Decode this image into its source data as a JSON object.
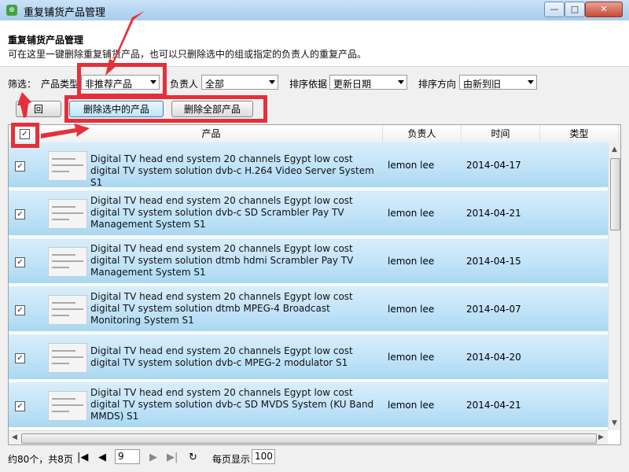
{
  "window": {
    "title": "重复铺货产品管理",
    "app_icon": "app-logo-icon",
    "controls": {
      "minimize": "—",
      "maximize": "□",
      "close": "✕"
    }
  },
  "header": {
    "title": "重复铺货产品管理",
    "description": "可在这里一键删除重复铺货产品，也可以只删除选中的组或指定的负责人的重复产品。"
  },
  "filters": {
    "filter_label": "筛选：",
    "product_type_label": "产品类型",
    "product_type_value": "非推荐产品",
    "owner_label": "负责人",
    "owner_value": "全部",
    "sort_by_label": "排序依据",
    "sort_by_value": "更新日期",
    "sort_dir_label": "排序方向",
    "sort_dir_value": "由新到旧"
  },
  "actions": {
    "back_label": "回",
    "delete_selected_label": "删除选中的产品",
    "delete_all_label": "删除全部产品"
  },
  "table": {
    "select_all_checked": true,
    "columns": [
      "产品",
      "负责人",
      "时间",
      "类型"
    ],
    "rows": [
      {
        "checked": true,
        "name": "Digital TV head end system 20 channels Egypt low cost digital TV system solution dvb-c H.264 Video Server System S1",
        "owner": "lemon lee",
        "date": "2014-04-17",
        "type": ""
      },
      {
        "checked": true,
        "name": "Digital TV head end system 20 channels Egypt low cost digital TV system solution dvb-c SD Scrambler Pay TV Management System S1",
        "owner": "lemon lee",
        "date": "2014-04-21",
        "type": ""
      },
      {
        "checked": true,
        "name": "Digital TV head end system 20 channels Egypt low cost digital TV system solution dtmb hdmi Scrambler Pay TV Management System S1",
        "owner": "lemon lee",
        "date": "2014-04-15",
        "type": ""
      },
      {
        "checked": true,
        "name": "Digital TV head end system 20 channels Egypt low cost digital TV system solution dtmb MPEG-4 Broadcast Monitoring System S1",
        "owner": "lemon lee",
        "date": "2014-04-07",
        "type": ""
      },
      {
        "checked": true,
        "name": "Digital TV head end system 20 channels Egypt low cost digital TV system solution dvb-c MPEG-2 modulator S1",
        "owner": "lemon lee",
        "date": "2014-04-20",
        "type": ""
      },
      {
        "checked": true,
        "name": "Digital TV head end system 20 channels Egypt low cost digital TV system solution dvb-c SD MVDS System (KU Band MMDS) S1",
        "owner": "lemon lee",
        "date": "2014-04-21",
        "type": ""
      }
    ]
  },
  "pagination": {
    "summary": "约80个，共8页",
    "page": "9",
    "per_page_label": "每页显示",
    "per_page_value": "100",
    "icons": [
      "first-page-icon",
      "prev-page-icon",
      "next-page-icon",
      "last-page-icon",
      "refresh-icon"
    ]
  },
  "annotation_color": "#e5303a"
}
